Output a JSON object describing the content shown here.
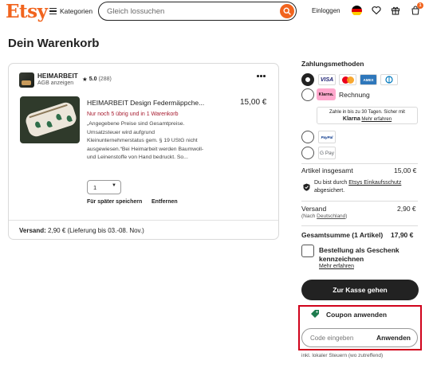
{
  "header": {
    "logo": "Etsy",
    "categories_label": "Kategorien",
    "search_placeholder": "Gleich lossuchen",
    "signin_label": "Einloggen",
    "cart_count": "1"
  },
  "page": {
    "title": "Dein Warenkorb"
  },
  "cart": {
    "shop": {
      "name": "HEIMARBEIT",
      "agb": "AGB anzeigen",
      "rating": "5.0",
      "review_count": "(288)"
    },
    "item": {
      "title": "HEIMARBEIT Design Federmäppche...",
      "price": "15,00 €",
      "stock_note": "Nur noch 5 übrig und in 1 Warenkorb",
      "notice": "„Angegebene Preise sind Gesamtpreise. Umsatzsteuer wird aufgrund Kleinunternehmerstatus gem. § 19 UStG nicht ausgewiesen.“Bei Heimarbeit werden Baumwoll- und Leinenstoffe von Hand bedruckt. So...",
      "quantity": "1",
      "save_later": "Für später speichern",
      "remove": "Entfernen"
    },
    "shipping": {
      "label": "Versand:",
      "text": "2,90 € (Lieferung bis 03.-08. Nov.)"
    }
  },
  "summary": {
    "payment_title": "Zahlungsmethoden",
    "card_logos": [
      "VISA",
      "Mastercard",
      "AMEX",
      "Diners Club"
    ],
    "klarna_badge": "Klarna.",
    "rechnung_label": "Rechnung",
    "klarna_info_line1": "Zahle in bis zu 30 Tagen. Sicher mit",
    "klarna_info_brand": "Klarna",
    "klarna_info_link": "Mehr erfahren",
    "paypal_label": "PayPal",
    "gpay_label": "G Pay",
    "items_total_label": "Artikel insgesamt",
    "items_total_value": "15,00 €",
    "protection_text_pre": "Du bist durch",
    "protection_link": "Etsys Einkaufsschutz",
    "protection_text_post": "abgesichert.",
    "shipping_label": "Versand",
    "shipping_value": "2,90 €",
    "shipping_note_pre": "(Nach",
    "shipping_note_link": "Deutschland",
    "shipping_note_post": ")",
    "total_label": "Gesamtsumme (1 Artikel)",
    "total_value": "17,90 €",
    "gift_label": "Bestellung als Geschenk kennzeichnen",
    "gift_link": "Mehr erfahren",
    "checkout_label": "Zur Kasse gehen",
    "coupon_title": "Coupon anwenden",
    "coupon_placeholder": "Code eingeben",
    "coupon_apply": "Anwenden",
    "tax_note": "inkl. lokaler Steuern (wo zutreffend)"
  },
  "colors": {
    "brand": "#F1641E",
    "highlight": "#D0021B",
    "stock_red": "#A61A2E",
    "button_dark": "#222222"
  }
}
